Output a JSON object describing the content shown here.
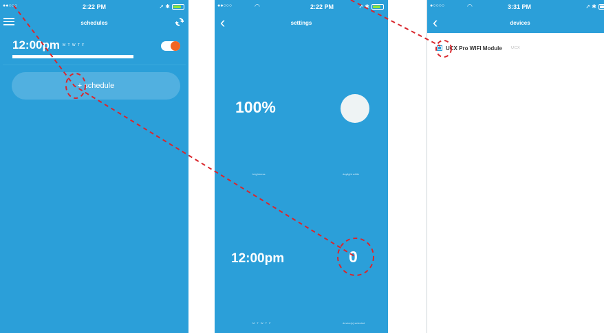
{
  "accent_color": "#2b9fd9",
  "toggle_color": "#f26522",
  "annotation_color": "#d9262c",
  "screens": [
    {
      "status": {
        "dots": "●●○○○",
        "time": "2:22 PM",
        "right": "➚ ✱"
      },
      "nav": {
        "title": "schedules",
        "left_icon": "menu-icon",
        "right_icon": "refresh-icon"
      },
      "schedule": {
        "time": "12:00pm",
        "days": "M T W T F"
      },
      "add_label": "+ schedule"
    },
    {
      "status": {
        "dots": "●●○○○",
        "time": "2:22 PM",
        "right": "➚ ✱"
      },
      "nav": {
        "title": "settings",
        "left_icon": "back-icon"
      },
      "brightness_value": "100%",
      "brightness_label": "brightness",
      "daylight_label": "daylight white",
      "time_value": "12:00pm",
      "count_value": "0",
      "days_label": "M T W T F",
      "devices_label": "device(s) selected"
    },
    {
      "status": {
        "dots": "●○○○○",
        "time": "3:31 PM",
        "right": "➚ ✱"
      },
      "nav": {
        "title": "devices",
        "left_icon": "back-icon"
      },
      "device": {
        "name": "UCX Pro WIFI Module",
        "type": "UCX"
      }
    }
  ]
}
